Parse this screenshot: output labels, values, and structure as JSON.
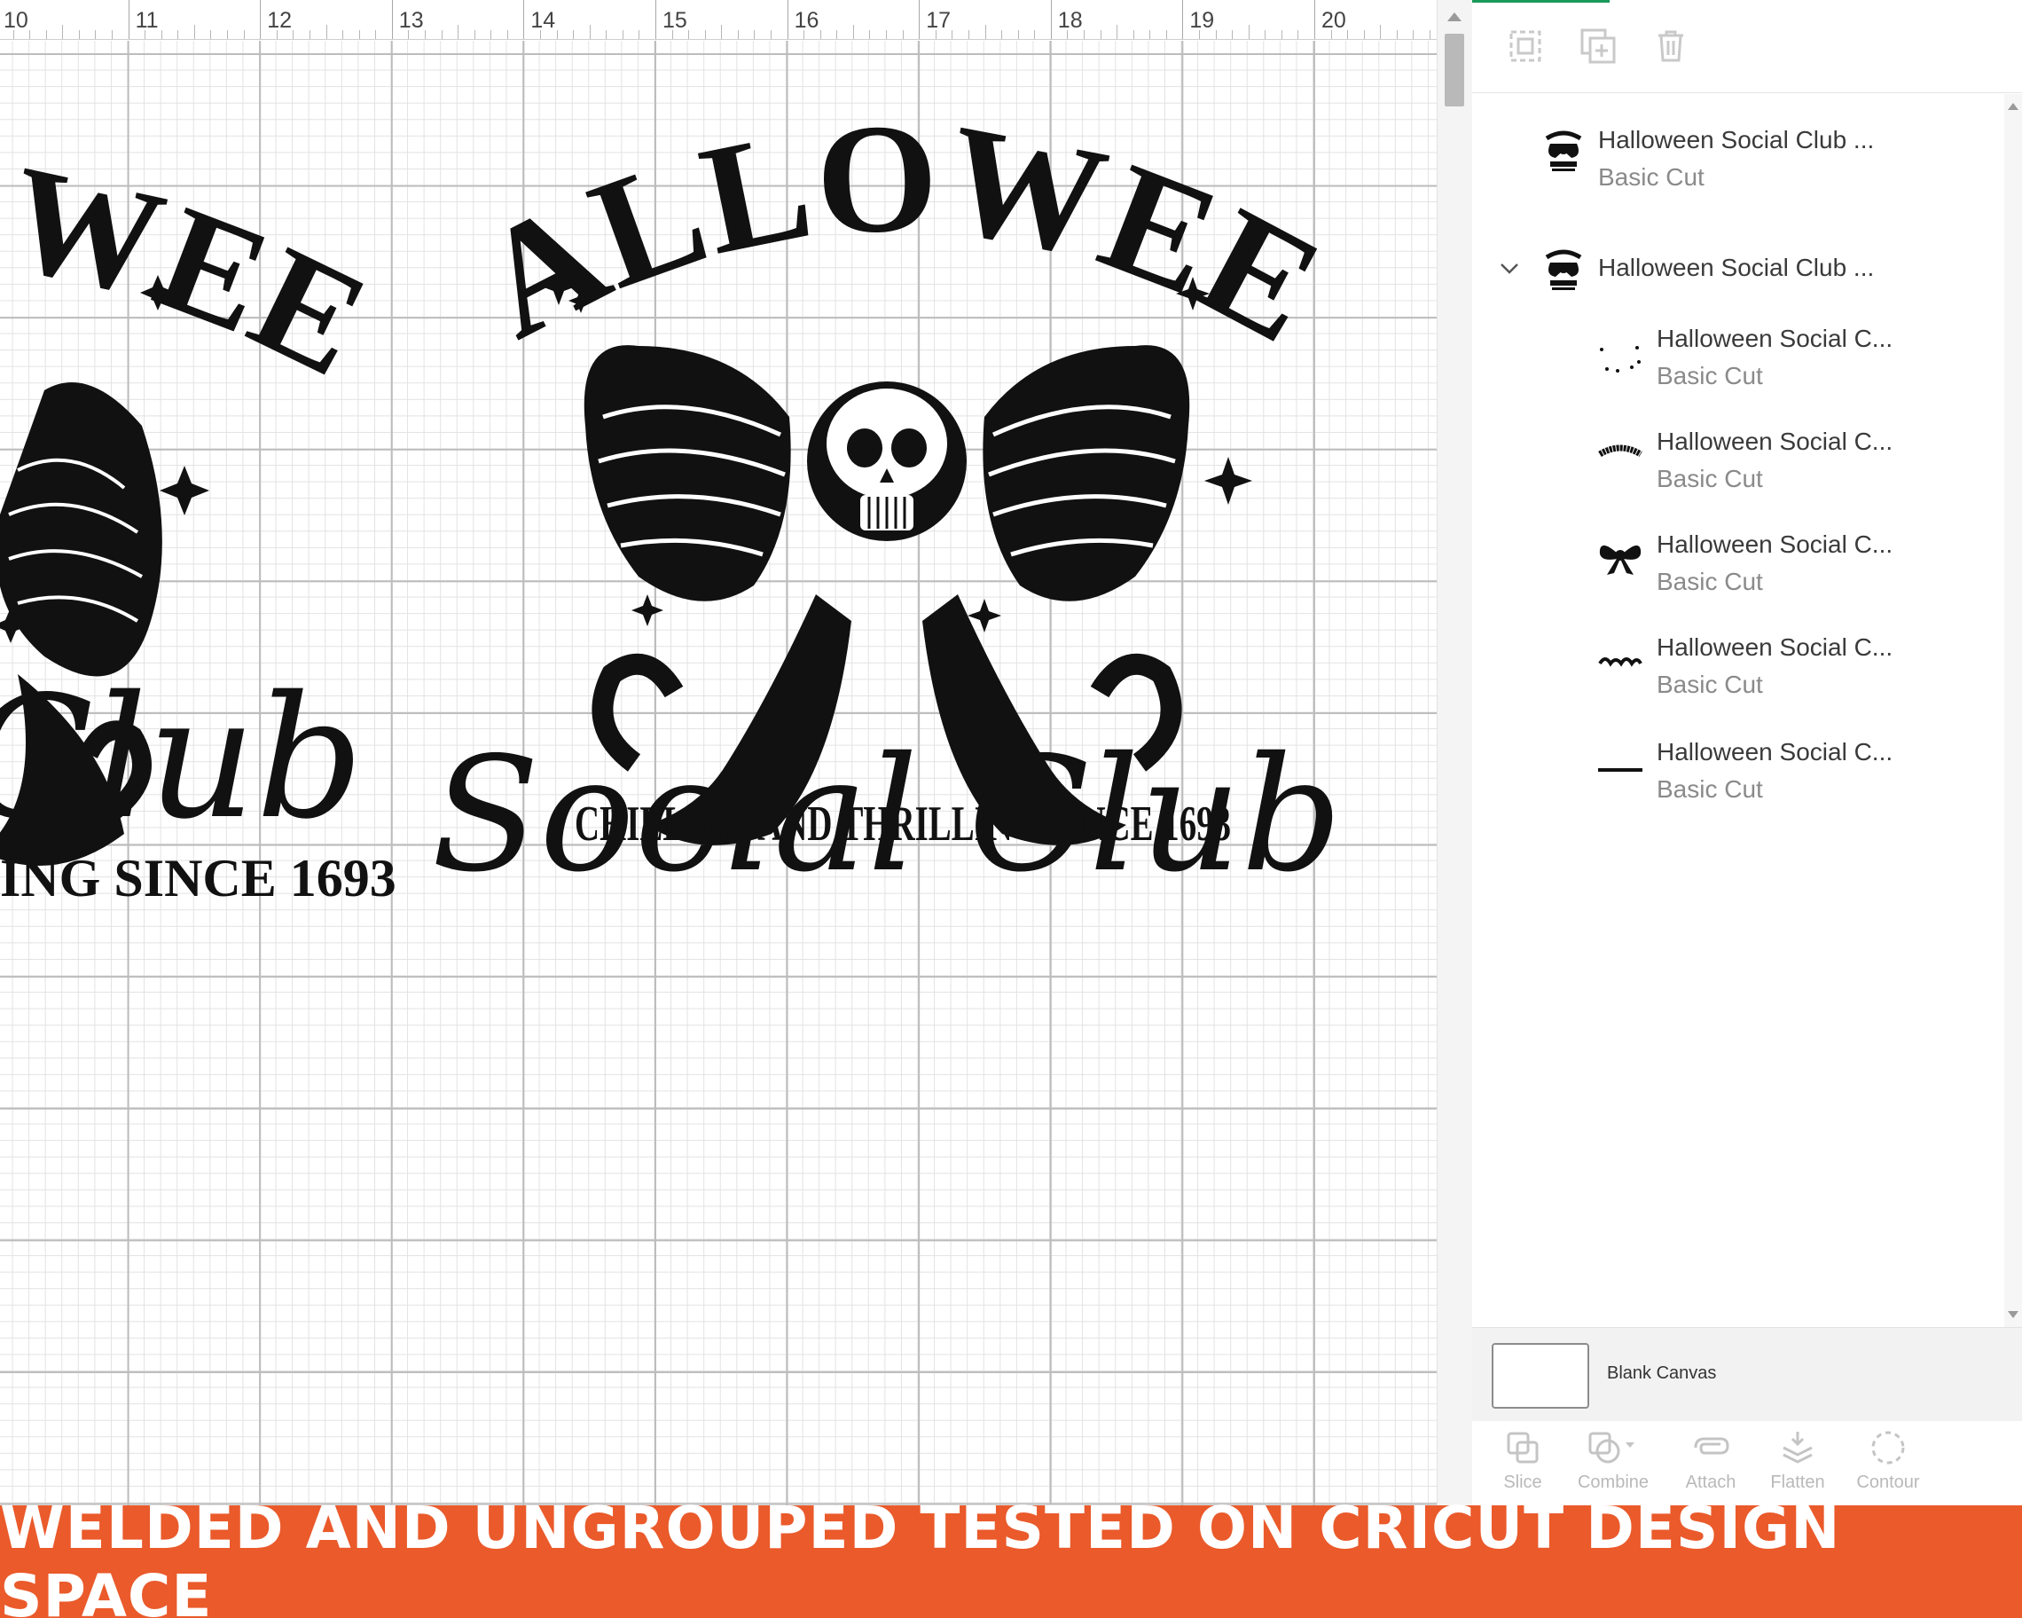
{
  "ruler": {
    "labels": [
      "10",
      "11",
      "12",
      "13",
      "14",
      "15",
      "16",
      "17",
      "18",
      "19",
      "20"
    ]
  },
  "design": {
    "arc_title": "HALLOWEEN",
    "script_title": "Social Club",
    "tagline": "CHILLING AND THRILLING SINCE 1693",
    "partial_arc": "WEEN",
    "partial_script": "Club",
    "partial_tagline": "ING SINCE 1693"
  },
  "layers": [
    {
      "name": "Halloween Social Club ...",
      "sub": "Basic Cut",
      "thumb": "halloween-design-thumb-icon",
      "indent": 0
    },
    {
      "name": "Halloween Social Club ...",
      "sub": "",
      "thumb": "halloween-design-thumb-icon",
      "indent": 0,
      "expanded": true
    },
    {
      "name": "Halloween Social C...",
      "sub": "Basic Cut",
      "thumb": "stars-thumb-icon",
      "indent": 1
    },
    {
      "name": "Halloween Social C...",
      "sub": "Basic Cut",
      "thumb": "halloween-text-thumb-icon",
      "indent": 1
    },
    {
      "name": "Halloween Social C...",
      "sub": "Basic Cut",
      "thumb": "bow-thumb-icon",
      "indent": 1
    },
    {
      "name": "Halloween Social C...",
      "sub": "Basic Cut",
      "thumb": "social-club-text-thumb-icon",
      "indent": 1
    },
    {
      "name": "Halloween Social C...",
      "sub": "Basic Cut",
      "thumb": "tagline-thumb-icon",
      "indent": 1
    }
  ],
  "canvas_row": {
    "label": "Blank Canvas"
  },
  "bottom_tools": [
    {
      "label": "Slice",
      "icon": "slice-icon"
    },
    {
      "label": "Combine",
      "icon": "combine-icon"
    },
    {
      "label": "Attach",
      "icon": "attach-icon"
    },
    {
      "label": "Flatten",
      "icon": "flatten-icon"
    },
    {
      "label": "Contour",
      "icon": "contour-icon"
    }
  ],
  "toolbar_icons": [
    "group-icon",
    "duplicate-icon",
    "delete-icon"
  ],
  "banner": {
    "text": "WELDED AND UNGROUPED TESTED ON CRICUT DESIGN SPACE"
  },
  "colors": {
    "banner_bg": "#ea5a2b",
    "banner_text": "#ffffff",
    "active_tab": "#1a9a5a",
    "ink": "#111111"
  }
}
